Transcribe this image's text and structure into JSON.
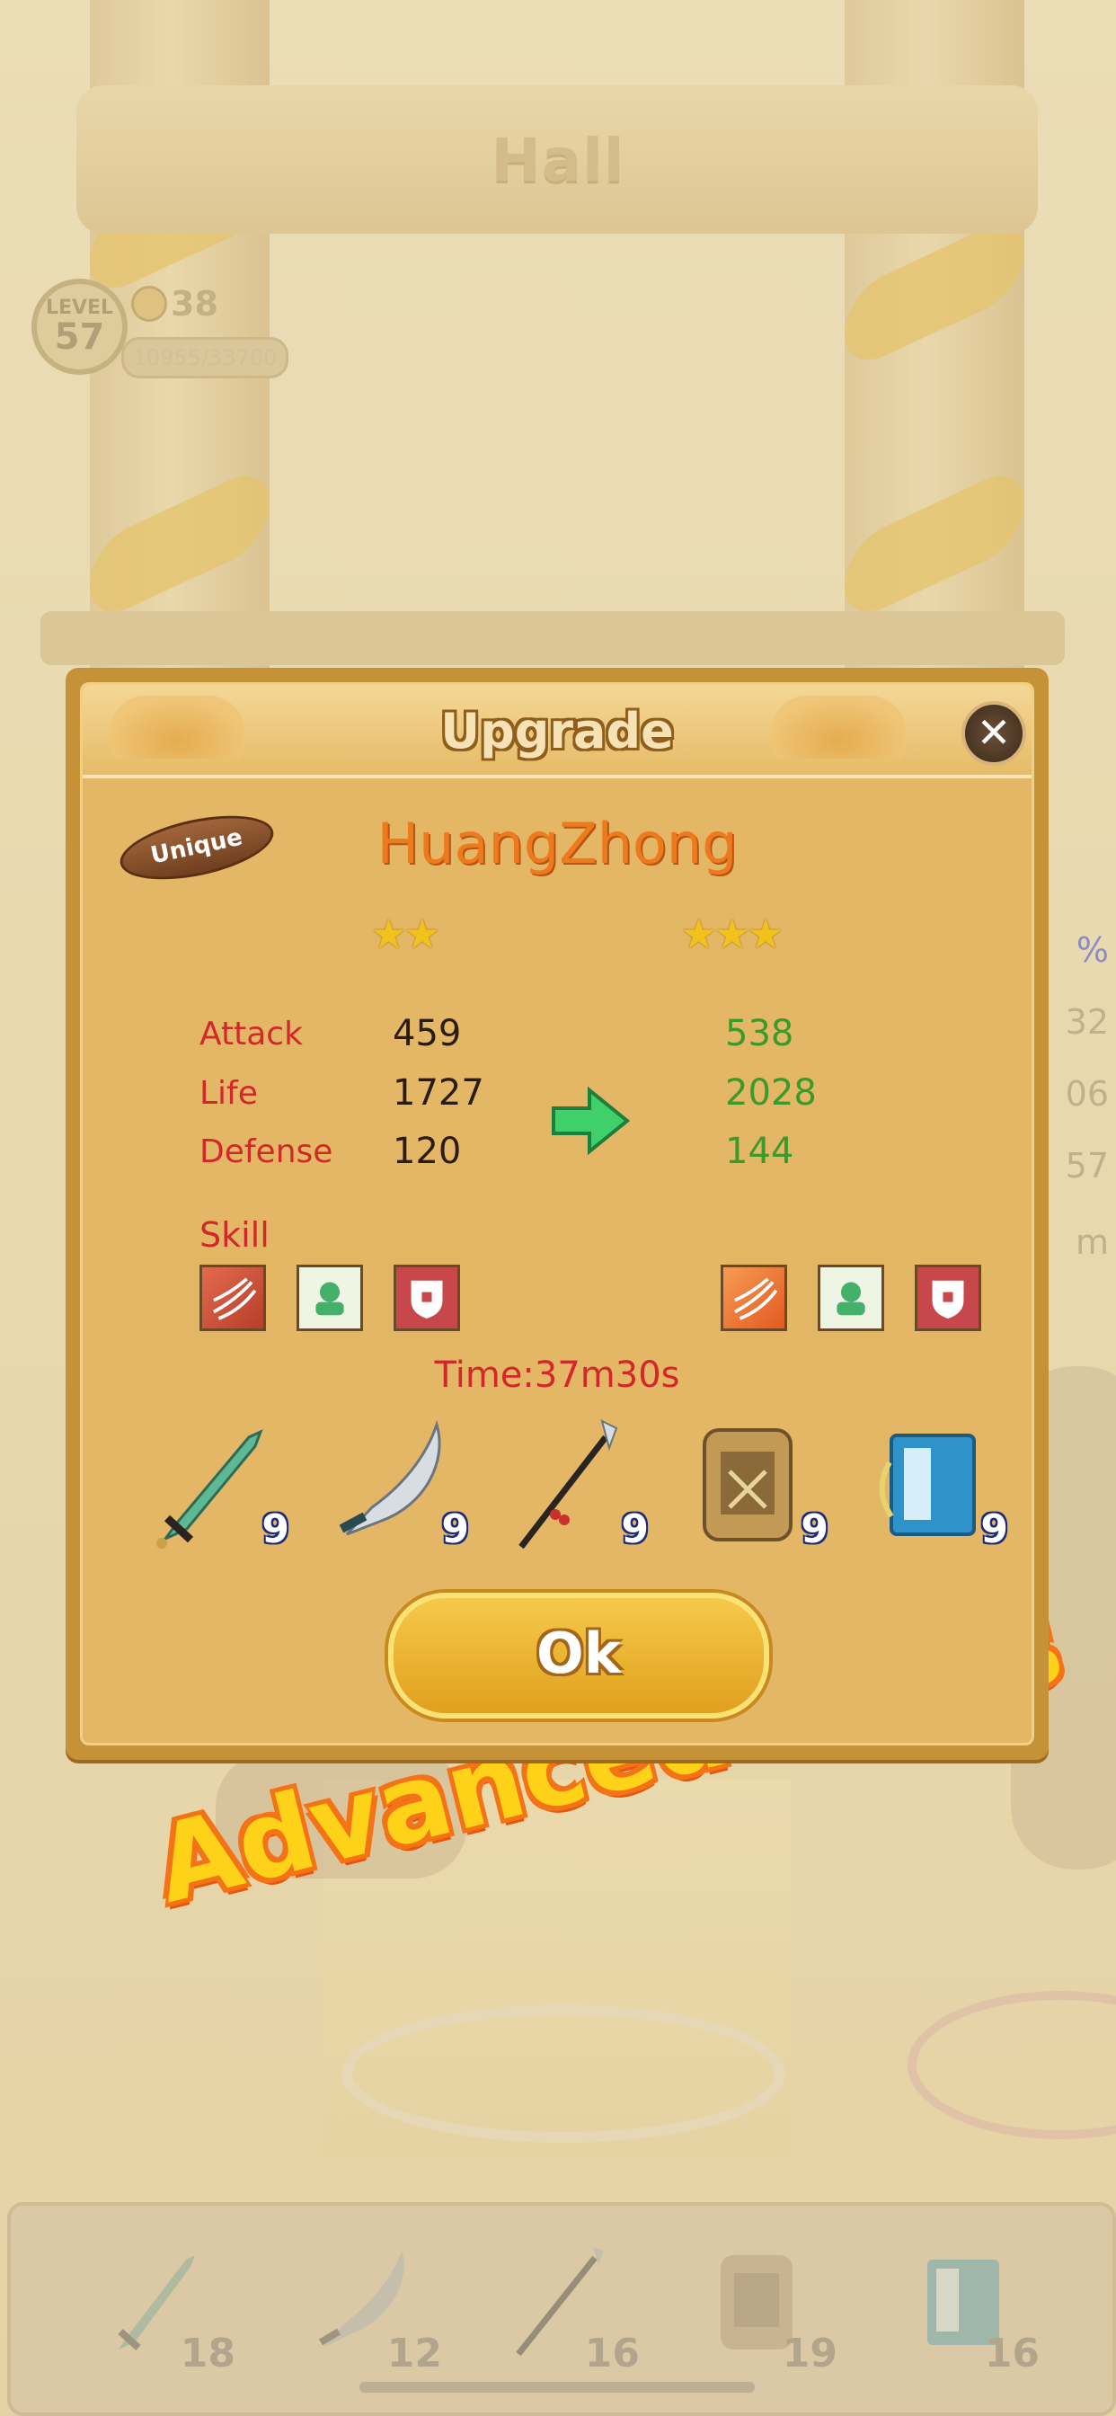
{
  "background": {
    "hall_title": "Hall",
    "player": {
      "level_label": "LEVEL",
      "level": "57",
      "coins": "38",
      "xp": "10955/33700"
    },
    "side_values": [
      "%",
      "32",
      "06",
      "57",
      "m"
    ]
  },
  "dialog": {
    "title": "Upgrade",
    "rarity": "Unique",
    "hero_name": "HuangZhong",
    "stars_before": 2,
    "stars_after": 3,
    "stats": [
      {
        "label": "Attack",
        "before": "459",
        "after": "538"
      },
      {
        "label": "Life",
        "before": "1727",
        "after": "2028"
      },
      {
        "label": "Defense",
        "before": "120",
        "after": "144"
      }
    ],
    "skill_label": "Skill",
    "skills_before": [
      "claw-skill-icon",
      "heal-skill-icon",
      "shield-skill-icon"
    ],
    "skills_after": [
      "claw-skill-icon",
      "heal-skill-icon",
      "shield-skill-icon"
    ],
    "timer": "Time:37m30s",
    "materials": [
      {
        "icon": "jade-sword-icon",
        "qty": "9"
      },
      {
        "icon": "broadsword-icon",
        "qty": "9"
      },
      {
        "icon": "spear-icon",
        "qty": "9"
      },
      {
        "icon": "armor-icon",
        "qty": "9"
      },
      {
        "icon": "book-icon",
        "qty": "9"
      }
    ],
    "ok_label": "Ok"
  },
  "promo_text": "Advanced skills",
  "inventory": [
    {
      "icon": "jade-sword-icon",
      "count": "18"
    },
    {
      "icon": "broadsword-icon",
      "count": "12"
    },
    {
      "icon": "spear-icon",
      "count": "16"
    },
    {
      "icon": "armor-icon",
      "count": "19"
    },
    {
      "icon": "book-icon",
      "count": "16"
    }
  ],
  "colors": {
    "stat_label": "#d3282a",
    "stat_new": "#3b9a2a",
    "hero_name": "#ee7a1e",
    "star": "#f2c21c"
  }
}
